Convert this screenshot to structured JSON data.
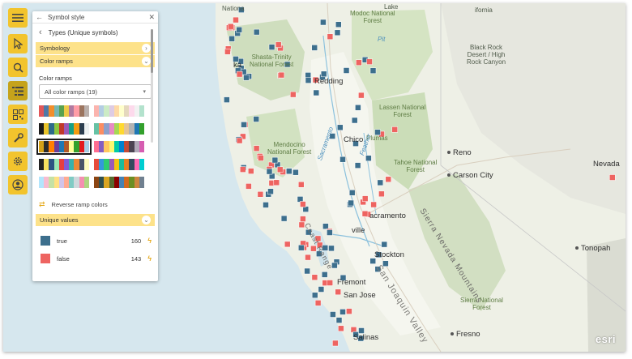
{
  "toolbar": {
    "icons": [
      "menu-icon",
      "select-pointer-icon",
      "search-icon",
      "layers-list-icon",
      "qr-grid-icon",
      "wrench-icon",
      "gear-icon",
      "user-icon"
    ],
    "active_index": 3,
    "color": "#f2c42d"
  },
  "panel": {
    "title": "Symbol style",
    "subtitle": "Types (Unique symbols)",
    "symbology_label": "Symbology",
    "color_ramps_label": "Color ramps",
    "color_ramps_section_label": "Color ramps",
    "select_value": "All color ramps (19)",
    "reverse_label": "Reverse ramp colors",
    "unique_values_label": "Unique values",
    "unique_values": [
      {
        "label": "true",
        "count": "160",
        "color": "#3d6f8d"
      },
      {
        "label": "false",
        "count": "143",
        "color": "#ee6461"
      }
    ],
    "ramps": [
      [
        "#e15759",
        "#4e79a7",
        "#f28e2b",
        "#76b7b2",
        "#59a14f",
        "#edc948",
        "#b07aa1",
        "#ff9da7",
        "#9c755f",
        "#bab0ac"
      ],
      [
        "#fbb4ae",
        "#b3cde3",
        "#ccebc5",
        "#decbe4",
        "#fed9a6",
        "#ffffcc",
        "#e5d8bd",
        "#fddaec",
        "#f2f2f2",
        "#b3e2cd"
      ],
      [
        "#1b1b1b",
        "#e8c32a",
        "#2d6b8a",
        "#8cc63f",
        "#c0392b",
        "#9b59b6",
        "#16a085",
        "#f39c12",
        "#2c3e50",
        "#ecf0f1"
      ],
      [
        "#66c2a5",
        "#fc8d62",
        "#8da0cb",
        "#e78ac3",
        "#a6d854",
        "#ffd92f",
        "#e5c494",
        "#b3b3b3",
        "#1f78b4",
        "#33a02c"
      ],
      [
        "#d4a017",
        "#2b2b2b",
        "#ff7f00",
        "#6a3d9a",
        "#1f78b4",
        "#b15928",
        "#ffff99",
        "#33a02c",
        "#e31a1c",
        "#a6cee3"
      ],
      [
        "#ff6f91",
        "#845ec2",
        "#ffc75f",
        "#f9f871",
        "#00c9a7",
        "#0081cf",
        "#c34a36",
        "#4b4453",
        "#b0a8b9",
        "#d65db1"
      ],
      [
        "#222222",
        "#f6e05e",
        "#2c5282",
        "#9ae6b4",
        "#e53e3e",
        "#805ad5",
        "#38b2ac",
        "#ed8936",
        "#4a5568",
        "#fefcbf"
      ],
      [
        "#e74c3c",
        "#3498db",
        "#2ecc71",
        "#9b59b6",
        "#f1c40f",
        "#1abc9c",
        "#e67e22",
        "#34495e",
        "#ff69b4",
        "#00ced1"
      ],
      [
        "#b3e5fc",
        "#f8bbd0",
        "#c5e1a5",
        "#ffe082",
        "#d1c4e9",
        "#ffab91",
        "#80cbc4",
        "#cfd8dc",
        "#f48fb1",
        "#aed581"
      ],
      [
        "#8b4513",
        "#2f4f4f",
        "#daa520",
        "#556b2f",
        "#8b0000",
        "#4682b4",
        "#d2691e",
        "#6b8e23",
        "#cd853f",
        "#708090"
      ]
    ],
    "selected_ramp_index": 4
  },
  "map": {
    "labels": {
      "modoc": "Modoc National\nForest",
      "black_rock": "Black Rock\nDesert / High\nRock Canyon",
      "shasta": "Shasta-Trinity\nNational Forest",
      "lassen": "Lassen National\nForest",
      "mendocino": "Mendocino\nNational Forest",
      "tahoe": "Tahoe National\nForest",
      "plumas": "Plumas",
      "sierra_forest": "Sierra National\nForest",
      "top_clip": "Nationa",
      "lake_clip": "Lake",
      "top_right": "ifornia",
      "redding": "Redding",
      "chico": "Chico",
      "reno": "Reno",
      "carson": "Carson City",
      "nevada": "Nevada",
      "sacramento": "acramento",
      "stockton": "Stockton",
      "fremont": "Fremont",
      "san_jose": "San Jose",
      "fresno": "Fresno",
      "salinas": "Salinas",
      "tonopah": "Tonopah",
      "ville": "ville",
      "ka": "ka",
      "sac_river": "Sacramento",
      "feather_river": "Feather",
      "sierra_nevada": "Sierra Nevada Mountains",
      "sjv": "San Joaquin Valley",
      "coast_range": "Coast Range",
      "pit": "Pit"
    },
    "attribution": "esri",
    "true_color": "#3d6f8d",
    "false_color": "#ee6461"
  }
}
